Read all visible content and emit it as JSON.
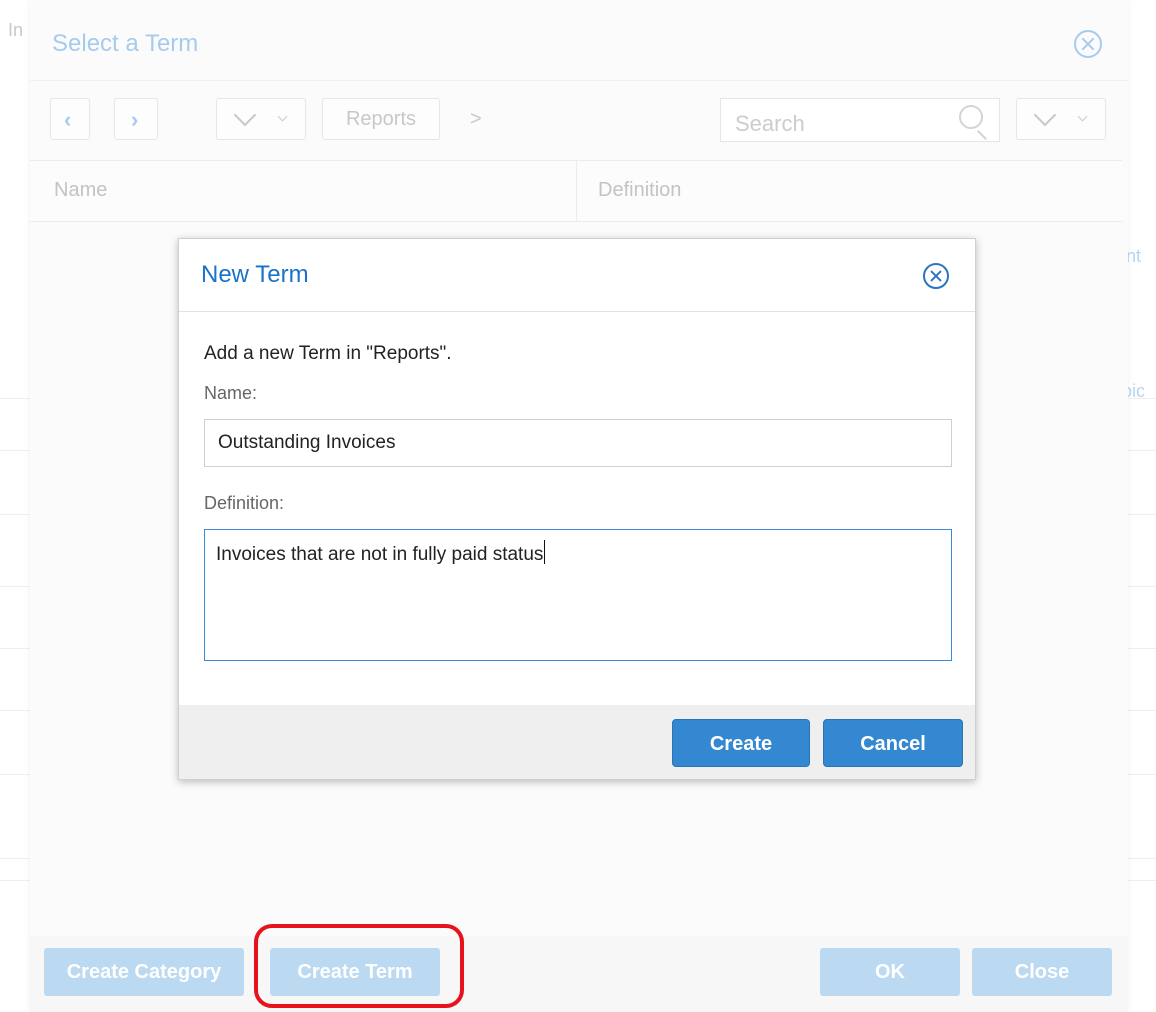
{
  "background": {
    "left_fragment": "In",
    "right_fragment_1": "nt",
    "right_fragment_2": "oic"
  },
  "select_dialog": {
    "title": "Select a Term",
    "toolbar": {
      "breadcrumb_item": "Reports",
      "breadcrumb_separator": ">",
      "search_placeholder": "Search"
    },
    "columns": [
      "Name",
      "Definition"
    ],
    "footer": {
      "create_category_label": "Create Category",
      "create_term_label": "Create Term",
      "ok_label": "OK",
      "close_label": "Close"
    }
  },
  "new_term_dialog": {
    "title": "New Term",
    "intro": "Add a new Term in \"Reports\".",
    "name_label": "Name:",
    "name_value": "Outstanding Invoices",
    "definition_label": "Definition:",
    "definition_value": "Invoices that are not in fully paid status",
    "create_label": "Create",
    "cancel_label": "Cancel"
  },
  "colors": {
    "accent": "#3388d1",
    "highlight": "#e8121c",
    "title_blue": "#1a73c9"
  },
  "icons": [
    "back-arrow-icon",
    "forward-arrow-icon",
    "chevron-down-icon",
    "search-icon",
    "close-circle-icon"
  ]
}
